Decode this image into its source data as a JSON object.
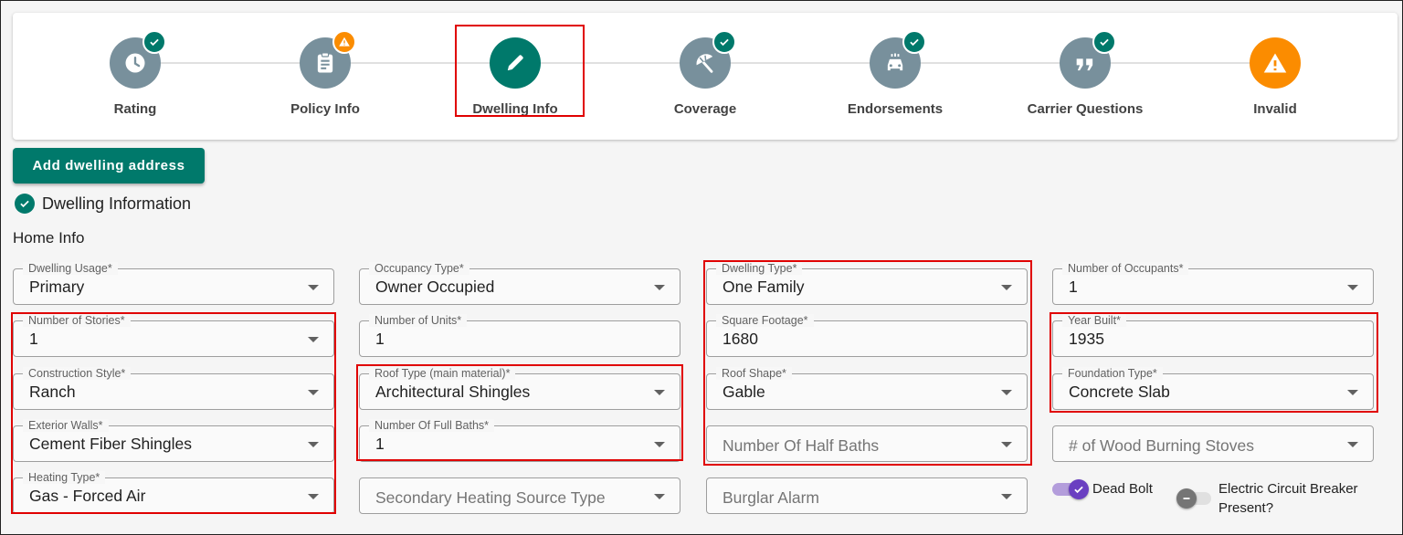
{
  "stepper": {
    "steps": [
      {
        "label": "Rating",
        "icon": "clock-icon",
        "badge": "check-icon"
      },
      {
        "label": "Policy Info",
        "icon": "clipboard-icon",
        "badge": "warning-icon"
      },
      {
        "label": "Dwelling Info",
        "icon": "pencil-icon",
        "badge": ""
      },
      {
        "label": "Coverage",
        "icon": "umbrella-icon",
        "badge": "check-icon"
      },
      {
        "label": "Endorsements",
        "icon": "car-icon",
        "badge": "check-icon"
      },
      {
        "label": "Carrier Questions",
        "icon": "quote-icon",
        "badge": "check-icon"
      },
      {
        "label": "Invalid",
        "icon": "warning-icon",
        "badge": ""
      }
    ],
    "active_step": "Dwelling Info"
  },
  "actions": {
    "add_dwelling_address": "Add dwelling address"
  },
  "section": {
    "title": "Dwelling Information",
    "status_icon": "check-circle-icon"
  },
  "home_info": {
    "title": "Home Info"
  },
  "fields": {
    "dwelling_usage": {
      "label": "Dwelling Usage*",
      "value": "Primary"
    },
    "number_of_stories": {
      "label": "Number of Stories*",
      "value": "1"
    },
    "construction_style": {
      "label": "Construction Style*",
      "value": "Ranch"
    },
    "exterior_walls": {
      "label": "Exterior Walls*",
      "value": "Cement Fiber Shingles"
    },
    "heating_type": {
      "label": "Heating Type*",
      "value": "Gas - Forced Air"
    },
    "occupancy_type": {
      "label": "Occupancy Type*",
      "value": "Owner Occupied"
    },
    "number_of_units": {
      "label": "Number of Units*",
      "value": "1"
    },
    "roof_type": {
      "label": "Roof Type (main material)*",
      "value": "Architectural Shingles"
    },
    "number_of_full_baths": {
      "label": "Number Of Full Baths*",
      "value": "1"
    },
    "secondary_heating": {
      "placeholder": "Secondary Heating Source Type"
    },
    "dwelling_type": {
      "label": "Dwelling Type*",
      "value": "One Family"
    },
    "square_footage": {
      "label": "Square Footage*",
      "value": "1680"
    },
    "roof_shape": {
      "label": "Roof Shape*",
      "value": "Gable"
    },
    "number_of_half_baths": {
      "placeholder": "Number Of Half Baths"
    },
    "burglar_alarm": {
      "placeholder": "Burglar Alarm"
    },
    "number_of_occupants": {
      "label": "Number of Occupants*",
      "value": "1"
    },
    "year_built": {
      "label": "Year Built*",
      "value": "1935"
    },
    "foundation_type": {
      "label": "Foundation Type*",
      "value": "Concrete Slab"
    },
    "wood_burning_stoves": {
      "placeholder": "# of Wood Burning Stoves"
    }
  },
  "toggles": {
    "dead_bolt": {
      "label": "Dead Bolt",
      "checked": true
    },
    "electric_circuit_breaker": {
      "label_line1": "Electric Circuit Breaker",
      "label_line2": "Present?",
      "checked": false
    }
  },
  "colors": {
    "primary": "#00796b",
    "warning": "#fb8c00",
    "inactive": "#78909c",
    "toggle_on": "#6a3fc1",
    "highlight": "#e00000"
  }
}
